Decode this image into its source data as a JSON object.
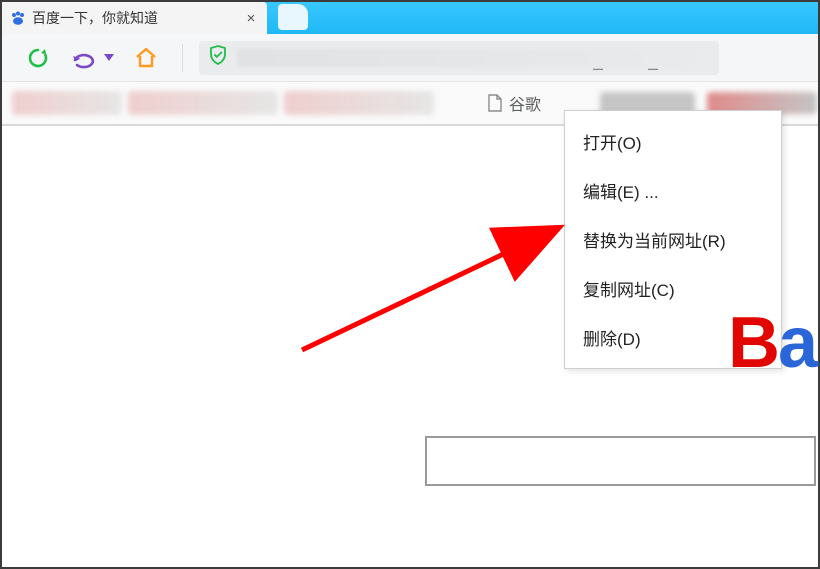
{
  "tab": {
    "title": "百度一下，你就知道",
    "close_glyph": "×"
  },
  "toolbar": {},
  "bookmarks": {
    "google_label": "谷歌"
  },
  "context_menu": {
    "items": [
      "打开(O)",
      "编辑(E) ...",
      "替换为当前网址(R)",
      "复制网址(C)",
      "删除(D)"
    ]
  },
  "logo_fragment": {
    "left": "B",
    "right": "a"
  },
  "colors": {
    "tabstrip": "#1fb8f6",
    "reload": "#1fbe4b",
    "back": "#7a48c8",
    "home": "#ff9a1f",
    "shield": "#1fbe4b",
    "arrow": "#ff0000",
    "logo_red": "#e10602",
    "logo_blue": "#2b66d9"
  }
}
